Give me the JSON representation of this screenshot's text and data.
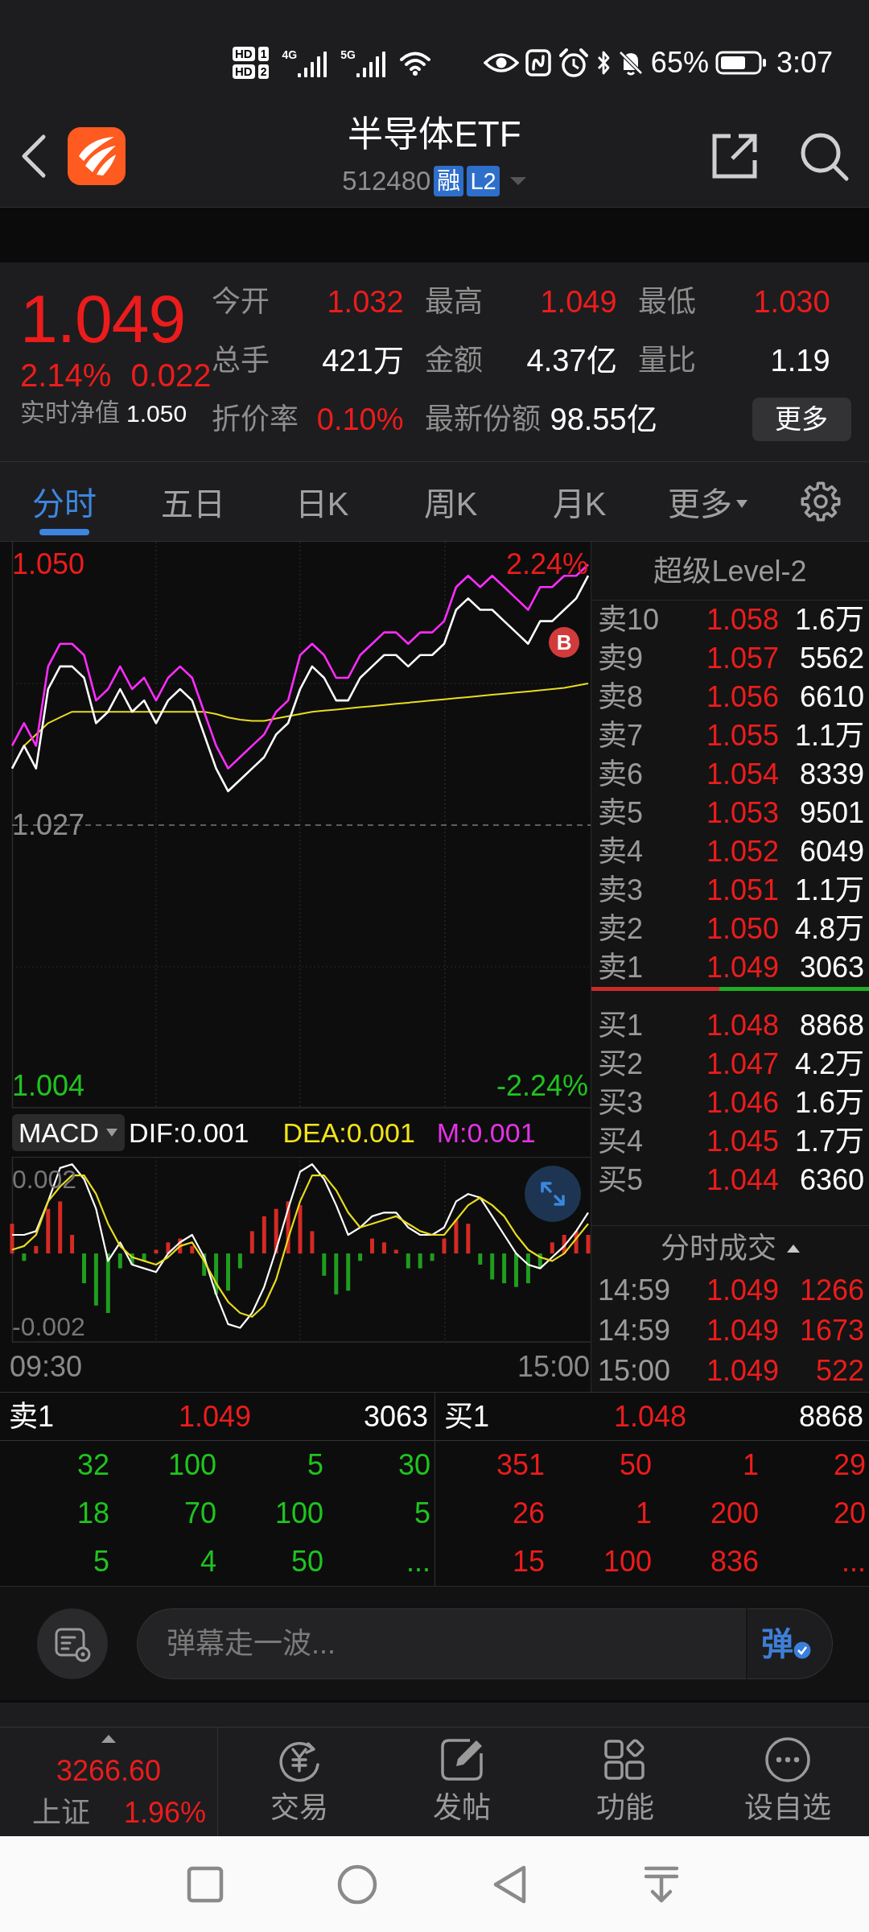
{
  "status_bar": {
    "sim_tags": [
      {
        "label": "HD",
        "slot": "1"
      },
      {
        "label": "HD",
        "slot": "2"
      }
    ],
    "networks": [
      "4G",
      "5G"
    ],
    "battery": "65%",
    "time": "3:07"
  },
  "header": {
    "title": "半导体ETF",
    "code": "512480",
    "badges": [
      {
        "text": "融"
      },
      {
        "text": "L2"
      }
    ]
  },
  "quote": {
    "price": "1.049",
    "change_pct": "2.14%",
    "change": "0.022",
    "nav_label": "实时净值",
    "nav_value": "1.050",
    "stats": [
      {
        "label": "今开",
        "value": "1.032",
        "color": "#ec1c1c"
      },
      {
        "label": "最高",
        "value": "1.049",
        "color": "#ec1c1c"
      },
      {
        "label": "最低",
        "value": "1.030",
        "color": "#ec1c1c"
      },
      {
        "label": "总手",
        "value": "421万",
        "color": "#ffffff"
      },
      {
        "label": "金额",
        "value": "4.37亿",
        "color": "#ffffff"
      },
      {
        "label": "量比",
        "value": "1.19",
        "color": "#ffffff"
      },
      {
        "label": "折价率",
        "value": "0.10%",
        "color": "#ec1c1c"
      },
      {
        "label": "最新份额",
        "value": "98.55亿",
        "color": "#ffffff"
      }
    ],
    "more_button": "更多"
  },
  "tabs": [
    {
      "label": "分时",
      "selected": true,
      "kind": "tab"
    },
    {
      "label": "五日",
      "selected": false,
      "kind": "tab"
    },
    {
      "label": "日K",
      "selected": false,
      "kind": "tab"
    },
    {
      "label": "周K",
      "selected": false,
      "kind": "tab"
    },
    {
      "label": "月K",
      "selected": false,
      "kind": "tab"
    },
    {
      "label": "更多",
      "selected": false,
      "kind": "menu"
    }
  ],
  "price_chart": {
    "chart_data": {
      "type": "line",
      "ylim": [
        1.002,
        1.052
      ],
      "yticks": [
        {
          "value": 1.05,
          "label": "1.050"
        },
        {
          "value": 1.004,
          "label": "1.004"
        }
      ],
      "grid": true,
      "ref_lines": [
        {
          "axis": "y",
          "value": 1.027,
          "label": "1.027",
          "color": "#7a7a7a"
        }
      ],
      "series": [
        {
          "color": "#ffffff",
          "values": [
            1.032,
            1.034,
            1.032,
            1.039,
            1.041,
            1.041,
            1.04,
            1.036,
            1.037,
            1.039,
            1.037,
            1.038,
            1.036,
            1.038,
            1.039,
            1.038,
            1.035,
            1.032,
            1.03,
            1.031,
            1.032,
            1.033,
            1.035,
            1.036,
            1.039,
            1.041,
            1.04,
            1.038,
            1.038,
            1.04,
            1.041,
            1.042,
            1.042,
            1.041,
            1.042,
            1.042,
            1.043,
            1.046,
            1.047,
            1.046,
            1.046,
            1.045,
            1.044,
            1.043,
            1.045,
            1.045,
            1.046,
            1.047,
            1.049
          ]
        },
        {
          "color": "#ff2cff",
          "values": [
            1.034,
            1.036,
            1.034,
            1.041,
            1.043,
            1.043,
            1.042,
            1.038,
            1.039,
            1.041,
            1.039,
            1.04,
            1.038,
            1.04,
            1.041,
            1.04,
            1.037,
            1.034,
            1.032,
            1.033,
            1.034,
            1.035,
            1.037,
            1.038,
            1.042,
            1.043,
            1.042,
            1.04,
            1.04,
            1.042,
            1.043,
            1.044,
            1.044,
            1.043,
            1.044,
            1.044,
            1.045,
            1.048,
            1.049,
            1.048,
            1.049,
            1.048,
            1.047,
            1.046,
            1.048,
            1.048,
            1.049,
            1.049,
            1.05
          ]
        },
        {
          "color": "#e8dc1e",
          "values": [
            1.032,
            1.034,
            1.035,
            1.036,
            1.0365,
            1.037,
            1.037,
            1.037,
            1.037,
            1.037,
            1.037,
            1.037,
            1.037,
            1.037,
            1.037,
            1.037,
            1.037,
            1.0368,
            1.0365,
            1.0363,
            1.0362,
            1.0362,
            1.0364,
            1.0366,
            1.0368,
            1.037,
            1.0371,
            1.0372,
            1.0373,
            1.0374,
            1.0375,
            1.0376,
            1.0377,
            1.0378,
            1.0379,
            1.038,
            1.0381,
            1.0382,
            1.0383,
            1.0384,
            1.0385,
            1.0386,
            1.0387,
            1.0388,
            1.0389,
            1.039,
            1.0391,
            1.0393,
            1.0395
          ]
        }
      ],
      "annotations": [
        "B"
      ]
    },
    "pct_labels": [
      "2.24%",
      "-2.24%"
    ]
  },
  "macd": {
    "indicator": "MACD",
    "legend": [
      {
        "label": "DIF:0.001",
        "color": "#ffffff"
      },
      {
        "label": "DEA:0.001",
        "color": "#f2e41a"
      },
      {
        "label": "M:0.001",
        "color": "#e632e6"
      }
    ],
    "chart_data": {
      "type": "bar",
      "ylim": [
        -0.0024,
        0.0026
      ],
      "yticks": [
        {
          "value": 0.002,
          "label": "0.002"
        },
        {
          "value": -0.002,
          "label": "-0.002"
        }
      ],
      "grid": true,
      "series": [
        {
          "type": "bar",
          "colors": [
            "#d42a24",
            "#1f9d1f",
            "#d42a24",
            "#d42a24",
            "#d42a24",
            "#d42a24",
            "#1f9d1f",
            "#1f9d1f",
            "#1f9d1f",
            "#1f9d1f",
            "#1f9d1f",
            "#1f9d1f",
            "#d42a24",
            "#d42a24",
            "#d42a24",
            "#d42a24",
            "#1f9d1f",
            "#1f9d1f",
            "#1f9d1f",
            "#1f9d1f",
            "#d42a24",
            "#d42a24",
            "#d42a24",
            "#d42a24",
            "#d42a24",
            "#d42a24",
            "#1f9d1f",
            "#1f9d1f",
            "#1f9d1f",
            "#1f9d1f",
            "#d42a24",
            "#d42a24",
            "#d42a24",
            "#1f9d1f",
            "#1f9d1f",
            "#1f9d1f",
            "#d42a24",
            "#d42a24",
            "#d42a24",
            "#1f9d1f",
            "#1f9d1f",
            "#1f9d1f",
            "#1f9d1f",
            "#1f9d1f",
            "#1f9d1f",
            "#d42a24",
            "#d42a24",
            "#d42a24",
            "#d42a24"
          ],
          "values": [
            0.0008,
            -0.0002,
            0.0002,
            0.0012,
            0.0014,
            0.0005,
            -0.0008,
            -0.0014,
            -0.0016,
            -0.0004,
            -0.0003,
            -0.0002,
            0.0001,
            0.0003,
            0.0004,
            0.0002,
            -0.0006,
            -0.0011,
            -0.001,
            -0.0004,
            0.0006,
            0.001,
            0.0012,
            0.0014,
            0.0013,
            0.0006,
            -0.0006,
            -0.0011,
            -0.001,
            -0.0002,
            0.0004,
            0.0003,
            0.0001,
            -0.0004,
            -0.0004,
            -0.0002,
            0.0004,
            0.0009,
            0.0008,
            -0.0003,
            -0.0007,
            -0.0008,
            -0.0009,
            -0.0008,
            -0.0004,
            0.0003,
            0.0005,
            0.0006,
            0.0005
          ]
        },
        {
          "type": "line",
          "color": "#ffffff",
          "values": [
            0.0005,
            0.0005,
            0.0006,
            0.0014,
            0.0023,
            0.0024,
            0.002,
            0.0012,
            -0.0002,
            0.0003,
            -0.0003,
            -0.0004,
            -0.0005,
            0,
            0.0003,
            0.0005,
            -0.0001,
            -0.0011,
            -0.0019,
            -0.002,
            -0.0016,
            -0.0009,
            0.0001,
            0.0012,
            0.0022,
            0.0024,
            0.002,
            0.0013,
            0.0005,
            0.0007,
            0.001,
            0.0011,
            0.0011,
            0.0007,
            0.0005,
            0.0005,
            0.0007,
            0.0014,
            0.0016,
            0.0015,
            0.001,
            0.0005,
            0,
            -0.0003,
            -0.0004,
            -0.0001,
            0.0002,
            0.0006,
            0.0011
          ]
        },
        {
          "type": "line",
          "color": "#e8dc1e",
          "values": [
            0.0001,
            0.0002,
            0.0005,
            0.0014,
            0.0018,
            0.0021,
            0.0021,
            0.0016,
            0.0008,
            0.0002,
            -0.0001,
            -0.0002,
            -0.0003,
            -0.0001,
            0.0002,
            0.0003,
            -0.0002,
            -0.0008,
            -0.0013,
            -0.0016,
            -0.0017,
            -0.0014,
            -0.0007,
            0.0004,
            0.0014,
            0.0021,
            0.0021,
            0.0017,
            0.0011,
            0.0007,
            0.0008,
            0.0009,
            0.001,
            0.0008,
            0.0006,
            0.0005,
            0.0005,
            0.0009,
            0.0013,
            0.0015,
            0.0013,
            0.001,
            0.0005,
            0.0001,
            -0.0001,
            -0.0002,
            0,
            0.0004,
            0.0008
          ]
        }
      ]
    },
    "time_labels": [
      "09:30",
      "15:00"
    ]
  },
  "order_book": {
    "title": "超级Level-2",
    "asks": [
      {
        "label": "卖10",
        "price": "1.058",
        "volume": "1.6万"
      },
      {
        "label": "卖9",
        "price": "1.057",
        "volume": "5562"
      },
      {
        "label": "卖8",
        "price": "1.056",
        "volume": "6610"
      },
      {
        "label": "卖7",
        "price": "1.055",
        "volume": "1.1万"
      },
      {
        "label": "卖6",
        "price": "1.054",
        "volume": "8339"
      },
      {
        "label": "卖5",
        "price": "1.053",
        "volume": "9501"
      },
      {
        "label": "卖4",
        "price": "1.052",
        "volume": "6049"
      },
      {
        "label": "卖3",
        "price": "1.051",
        "volume": "1.1万"
      },
      {
        "label": "卖2",
        "price": "1.050",
        "volume": "4.8万"
      },
      {
        "label": "卖1",
        "price": "1.049",
        "volume": "3063"
      }
    ],
    "ratio_bar": {
      "level": 0.46
    },
    "bids": [
      {
        "label": "买1",
        "price": "1.048",
        "volume": "8868"
      },
      {
        "label": "买2",
        "price": "1.047",
        "volume": "4.2万"
      },
      {
        "label": "买3",
        "price": "1.046",
        "volume": "1.6万"
      },
      {
        "label": "买4",
        "price": "1.045",
        "volume": "1.7万"
      },
      {
        "label": "买5",
        "price": "1.044",
        "volume": "6360"
      }
    ]
  },
  "trades": {
    "title": "分时成交",
    "rows": [
      {
        "time": "14:59",
        "price": "1.049",
        "volume": "1266"
      },
      {
        "time": "14:59",
        "price": "1.049",
        "volume": "1673"
      },
      {
        "time": "15:00",
        "price": "1.049",
        "volume": "522"
      }
    ]
  },
  "queue": {
    "sides": [
      {
        "kind": "ask",
        "label": "卖1",
        "price": "1.049",
        "volume": "3063",
        "orders": [
          [
            "32",
            "100",
            "5",
            "30"
          ],
          [
            "18",
            "70",
            "100",
            "5"
          ],
          [
            "5",
            "4",
            "50",
            "..."
          ]
        ]
      },
      {
        "kind": "bid",
        "label": "买1",
        "price": "1.048",
        "volume": "8868",
        "orders": [
          [
            "351",
            "50",
            "1",
            "29"
          ],
          [
            "26",
            "1",
            "200",
            "20"
          ],
          [
            "15",
            "100",
            "836",
            "..."
          ]
        ]
      }
    ]
  },
  "comment_bar": {
    "placeholder": "弹幕走一波...",
    "send_button": "弹"
  },
  "bottom_nav": {
    "index": {
      "value": "3266.60",
      "name": "上证",
      "change": "1.96%"
    },
    "items": [
      {
        "label": "交易"
      },
      {
        "label": "发帖"
      },
      {
        "label": "功能"
      },
      {
        "label": "设自选"
      }
    ]
  }
}
